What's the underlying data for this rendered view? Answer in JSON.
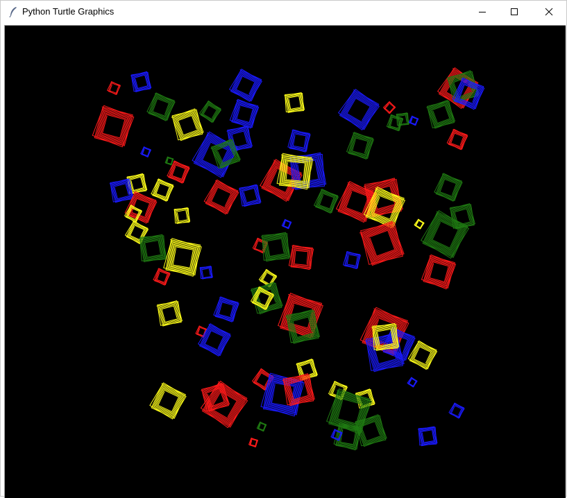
{
  "window": {
    "title": "Python Turtle Graphics"
  },
  "controls": {
    "minimize_icon": "minimize-icon",
    "maximize_icon": "maximize-icon",
    "close_icon": "close-icon"
  },
  "canvas": {
    "background": "#000000",
    "palette": {
      "red": "#ff1a1a",
      "green": "#1f7a12",
      "blue": "#1a1aff",
      "yellow": "#ffff1a"
    }
  }
}
